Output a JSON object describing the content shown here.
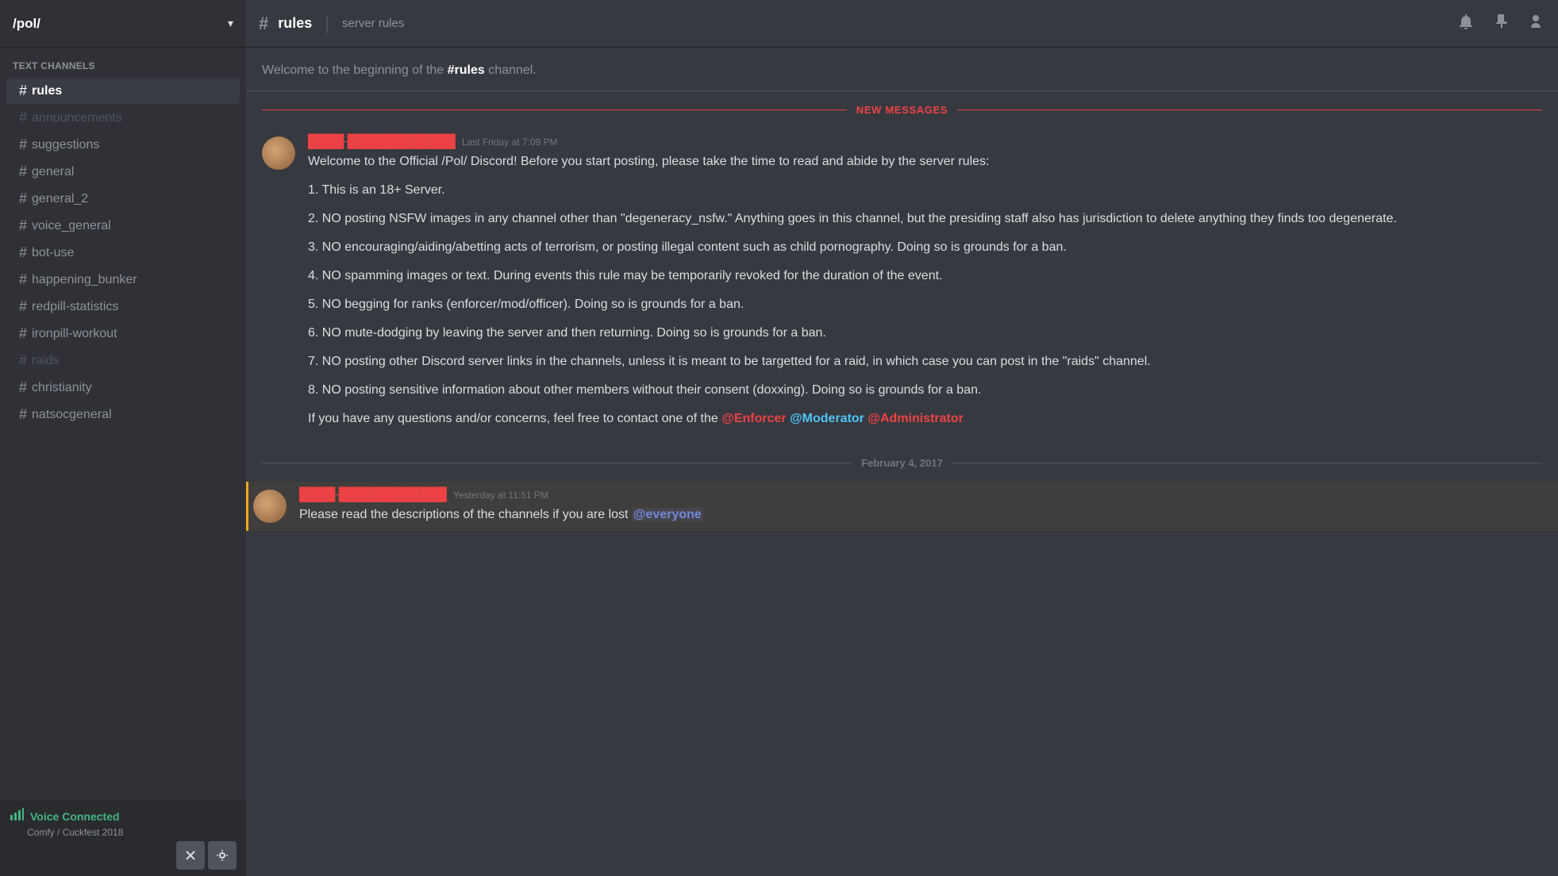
{
  "server": {
    "name": "/pol/",
    "chevron": "▾"
  },
  "sidebar": {
    "section_label": "TEXT CHANNELS",
    "channels": [
      {
        "name": "rules",
        "active": true,
        "inactive": false
      },
      {
        "name": "announcements",
        "active": false,
        "inactive": true
      },
      {
        "name": "suggestions",
        "active": false,
        "inactive": false
      },
      {
        "name": "general",
        "active": false,
        "inactive": false
      },
      {
        "name": "general_2",
        "active": false,
        "inactive": false
      },
      {
        "name": "voice_general",
        "active": false,
        "inactive": false
      },
      {
        "name": "bot-use",
        "active": false,
        "inactive": false
      },
      {
        "name": "happening_bunker",
        "active": false,
        "inactive": false
      },
      {
        "name": "redpill-statistics",
        "active": false,
        "inactive": false
      },
      {
        "name": "ironpill-workout",
        "active": false,
        "inactive": false
      },
      {
        "name": "raids",
        "active": false,
        "inactive": true
      },
      {
        "name": "christianity",
        "active": false,
        "inactive": false
      },
      {
        "name": "natsocgeneral",
        "active": false,
        "inactive": false
      }
    ],
    "voice": {
      "status": "Voice Connected",
      "channel": "Comfy / Cuckfest 2018"
    }
  },
  "header": {
    "hash": "#",
    "channel_name": "rules",
    "divider": "|",
    "description": "server rules",
    "bell_icon": "🔔",
    "pin_icon": "📌",
    "members_icon": "👤"
  },
  "messages": {
    "beginning_text": "Welcome to the beginning of the ",
    "beginning_channel": "#rules",
    "beginning_end": " channel.",
    "new_messages_label": "NEW MESSAGES",
    "message1": {
      "username": "████ ████████████",
      "timestamp": "Last Friday at 7:09 PM",
      "text_intro": "Welcome to the Official /Pol/ Discord! Before you start posting, please take the time to read and abide by the server rules:",
      "rules": [
        "1. This is an 18+ Server.",
        "2. NO posting NSFW images in any channel other than \"degeneracy_nsfw.\" Anything goes in this channel, but the presiding staff also has jurisdiction to delete anything they finds too degenerate.",
        "3. NO encouraging/aiding/abetting acts of terrorism, or posting illegal content such as child pornography. Doing so is grounds for a ban.",
        "4. NO spamming images or text. During events this rule may be temporarily revoked for the duration of the event.",
        "5. NO begging for ranks (enforcer/mod/officer). Doing so is grounds for a ban.",
        "6. NO mute-dodging by leaving the server and then returning. Doing so is grounds for a ban.",
        "7. NO posting other Discord server links in the channels, unless it is meant to be targetted for a raid, in which case you can post in the \"raids\" channel.",
        "8. NO posting sensitive information about other members without their consent (doxxing). Doing so is grounds for a ban."
      ],
      "contact_prefix": "If you have any questions and/or concerns, feel free to contact one of the ",
      "enforcer": "@Enforcer",
      "moderator": "@Moderator",
      "administrator": "@Administrator"
    },
    "date_divider": "February 4, 2017",
    "message2": {
      "username": "████ ████████████",
      "timestamp": "Yesterday at 11:51 PM",
      "text": "Please read the descriptions of the channels if you are lost ",
      "everyone": "@everyone"
    }
  }
}
